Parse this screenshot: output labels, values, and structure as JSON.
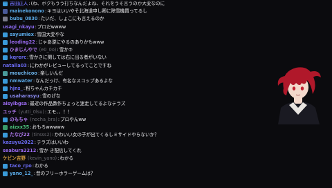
{
  "chat": {
    "messages": [
      {
        "badge": "#3a9ad9",
        "user": "吉田正人",
        "user_color": "#6a6af0",
        "handle": "",
        "text": "(わ、ボクもうう打ちなんだよね、それをうそ言うのか大変なのに"
      },
      {
        "badge": "#4a5a9a",
        "user": "mainekonono",
        "user_color": "#5aa9e6",
        "handle": "",
        "text": "キヨはいいやそ北海道申し卿に除雪機買ってるし"
      },
      {
        "badge": "#7a7a8a",
        "user": "bubu_0830",
        "user_color": "#5aa9e6",
        "handle": "",
        "text": "たいだ、しょこにも言えるのか"
      },
      {
        "badge": "",
        "user": "usagi_nkayu",
        "user_color": "#8a6af0",
        "handle": "",
        "text": "プロだwwww"
      },
      {
        "badge": "#3a9ad9",
        "user": "sayumiex",
        "user_color": "#5aa9e6",
        "handle": "",
        "text": "雪国大変やな"
      },
      {
        "badge": "#3a9ad9",
        "user": "leoding22",
        "user_color": "#9a6af0",
        "handle": "",
        "text": "じゃあ逆にやるのありかもwww"
      },
      {
        "badge": "#3a9ad9",
        "user": "ひまじんやで",
        "user_color": "#b07af0",
        "handle": "(e0_0o)",
        "text": "雪かキ"
      },
      {
        "badge": "#3a9ad9",
        "user": "kqrerc",
        "user_color": "#6a6af0",
        "handle": "",
        "text": "雪かきに関しては右に出る者がいない"
      },
      {
        "badge": "",
        "user": "natalla03",
        "user_color": "#6a6af0",
        "handle": "",
        "text": "にわかがレビューしてるってことですね"
      },
      {
        "badge": "#4a9a9a",
        "user": "mouchicoo",
        "user_color": "#6ab0e6",
        "handle": "",
        "text": "楽しいんだ"
      },
      {
        "badge": "#3a9ad9",
        "user": "nmwater",
        "user_color": "#5aa9e6",
        "handle": "",
        "text": "なんだっけ、有名なスコップあるよな"
      },
      {
        "badge": "#3a9ad9",
        "user": "hjns_",
        "user_color": "#6a6af0",
        "handle": "",
        "text": "粉ちゃんカチカチ"
      },
      {
        "badge": "#3a9ad9",
        "user": "usaharasyu",
        "user_color": "#8a8af0",
        "handle": "",
        "text": "雪のげな"
      },
      {
        "badge": "",
        "user": "aisyibgsa",
        "user_color": "#9a6af0",
        "handle": "",
        "text": "最近の作品数作ちょっと迷走してるよなテラズ"
      },
      {
        "badge": "",
        "user": "ユッチ",
        "user_color": "#b07af0",
        "handle": "(yutti_0lsu)",
        "text": "エモ、、！！"
      },
      {
        "badge": "#3a9ad9",
        "user": "のもちゃ",
        "user_color": "#b07af0",
        "handle": "(nocha_bra)",
        "text": "プロやんww"
      },
      {
        "badge": "#3a9a6a",
        "user": "aizxx35",
        "user_color": "#4ac07a",
        "handle": "",
        "text": "おもろwwwww"
      },
      {
        "badge": "#3a9ad9",
        "user": "たなび22",
        "user_color": "#b07af0",
        "handle": "(tinsss2)",
        "text": "かわいい女の子が出てくるしミサイドやらないか？"
      },
      {
        "badge": "",
        "user": "kazuyu2022",
        "user_color": "#6a6af0",
        "handle": "",
        "text": "テラズはいいわ"
      },
      {
        "badge": "",
        "user": "seabura2212",
        "user_color": "#9a6af0",
        "handle": "",
        "text": "雪か き配信してくれ"
      },
      {
        "badge": "",
        "user": "ケビン吉野",
        "user_color": "#d8a040",
        "handle": "(kevin_yano)",
        "text": "わかる"
      },
      {
        "badge": "#3a9ad9",
        "user": "taco_rpo",
        "user_color": "#6a6af0",
        "handle": "",
        "text": "わかる"
      },
      {
        "badge": "#3a9ad9",
        "user": "yano_12_",
        "user_color": "#5aa9e6",
        "handle": "",
        "text": "昔のフリーホラーゲームは？"
      }
    ]
  },
  "avatar": {
    "hair_color": "#b0182a",
    "skin_color": "#f3d9cc",
    "coat_color": "#1a1a22",
    "eye_color": "#c02030"
  }
}
